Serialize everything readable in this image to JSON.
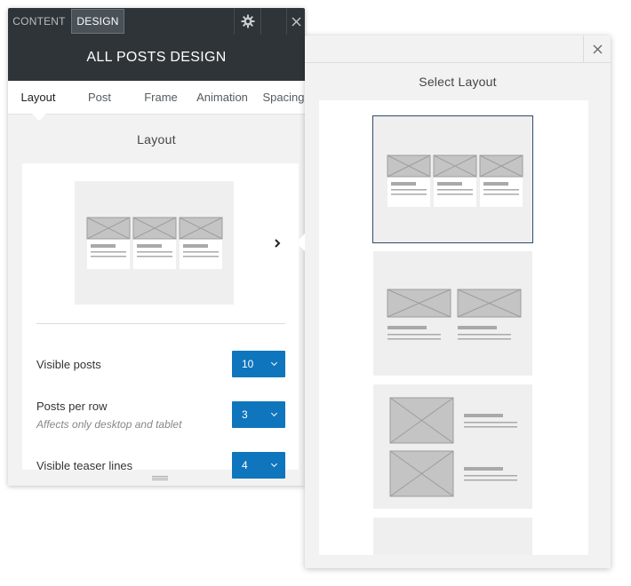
{
  "panel": {
    "tabs": {
      "content": "CONTENT",
      "design": "DESIGN"
    },
    "title": "ALL POSTS DESIGN",
    "subtabs": [
      {
        "label": "Layout",
        "active": true
      },
      {
        "label": "Post",
        "active": false
      },
      {
        "label": "Frame",
        "active": false
      },
      {
        "label": "Animation",
        "active": false
      },
      {
        "label": "Spacing",
        "active": false
      }
    ],
    "section_title": "Layout",
    "fields": {
      "visible_posts": {
        "label": "Visible posts",
        "value": "10"
      },
      "posts_per_row": {
        "label": "Posts per row",
        "hint": "Affects only desktop and tablet",
        "value": "3"
      },
      "visible_teaser_lines": {
        "label": "Visible teaser lines",
        "value": "4"
      }
    }
  },
  "picker": {
    "title": "Select Layout",
    "options": [
      {
        "id": "three-column-grid",
        "selected": true
      },
      {
        "id": "two-column-grid",
        "selected": false
      },
      {
        "id": "list-image-left",
        "selected": false
      },
      {
        "id": "more",
        "selected": false
      }
    ]
  },
  "colors": {
    "dark_bar": "#2f3438",
    "accent_blue": "#0f75bc",
    "panel_bg": "#f2f2f2",
    "thumb_bg": "#efefef",
    "placeholder_gray": "#bdbdbd"
  },
  "icons": {
    "settings": "gear-icon",
    "close": "close-icon",
    "next": "chevron-right-icon",
    "dropdown": "chevron-down-icon",
    "resize": "resize-grip-icon"
  }
}
